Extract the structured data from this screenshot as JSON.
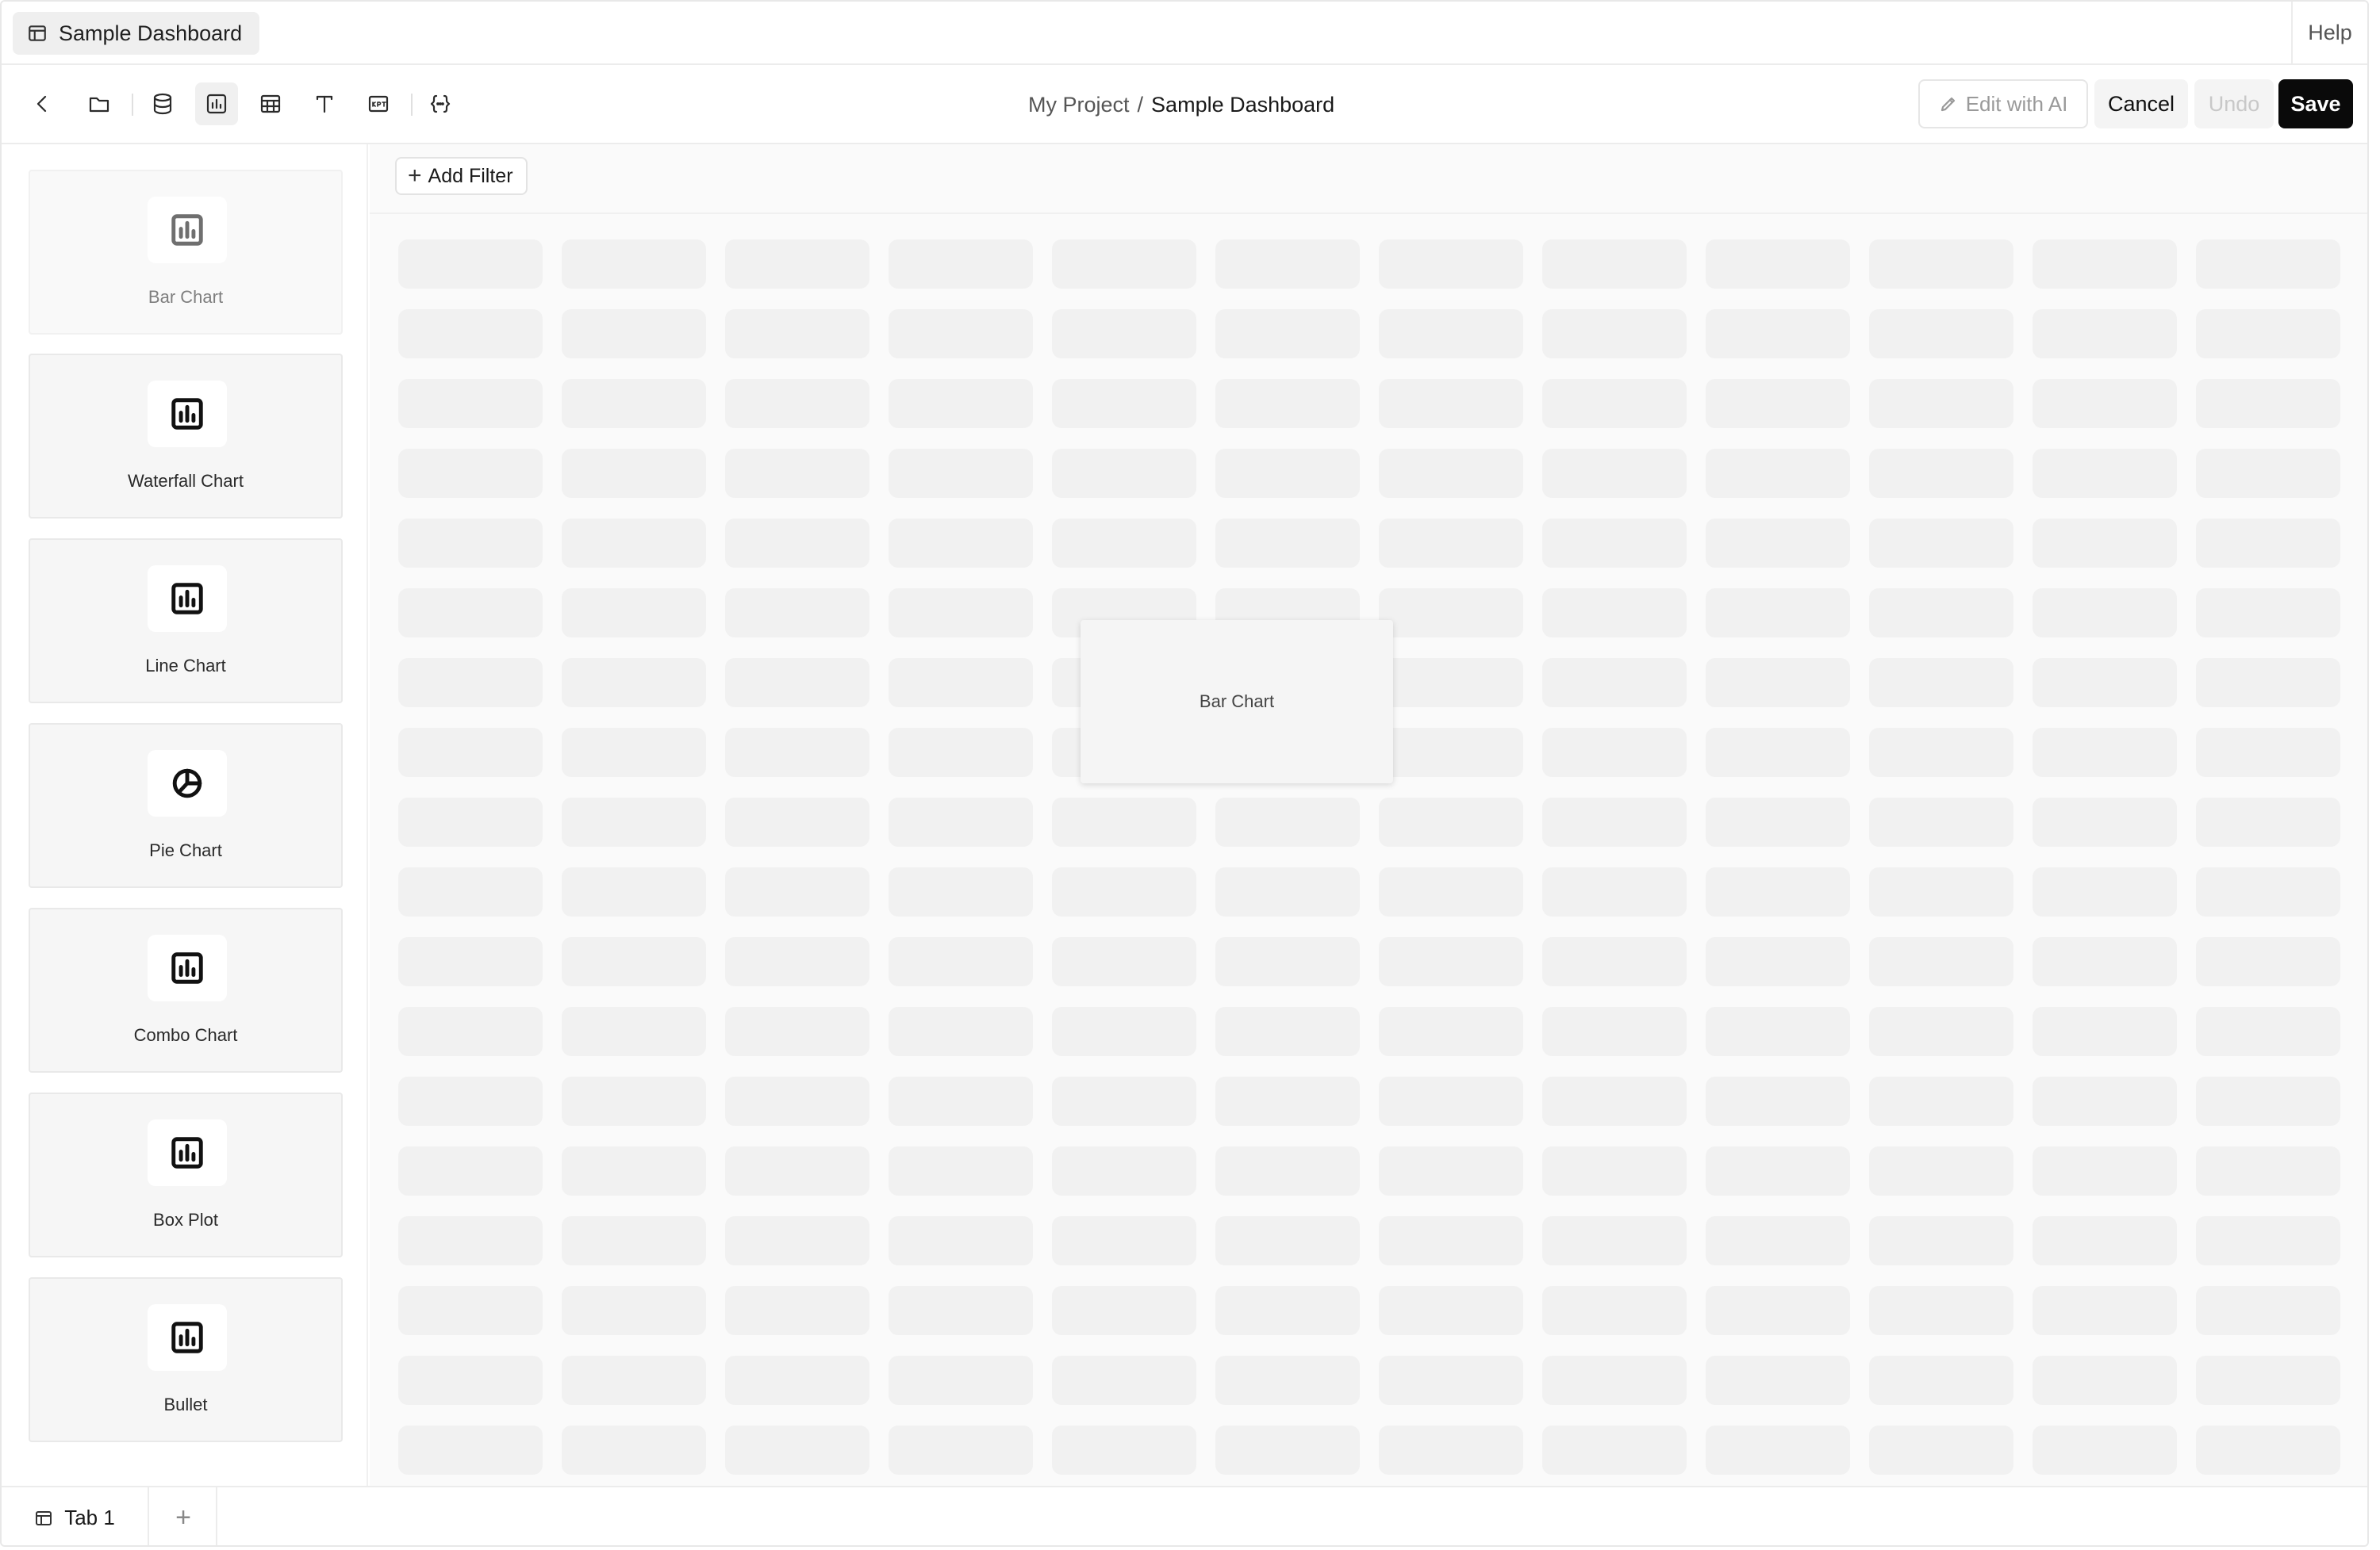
{
  "window": {
    "doc_tab_label": "Sample Dashboard",
    "help_label": "Help"
  },
  "toolbar": {
    "tools": [
      {
        "name": "back-icon"
      },
      {
        "name": "folder-icon"
      },
      {
        "name": "database-icon"
      },
      {
        "name": "chart-icon",
        "active": true
      },
      {
        "name": "table-icon"
      },
      {
        "name": "text-icon"
      },
      {
        "name": "kpi-icon"
      },
      {
        "name": "code-braces-icon"
      }
    ],
    "breadcrumb": {
      "project": "My Project",
      "separator": "/",
      "current": "Sample Dashboard"
    },
    "edit_ai_label": "Edit with AI",
    "cancel_label": "Cancel",
    "undo_label": "Undo",
    "save_label": "Save"
  },
  "sidebar": {
    "widgets": [
      {
        "label": "Bar Chart",
        "icon": "bar-chart-icon",
        "dimmed": true
      },
      {
        "label": "Waterfall Chart",
        "icon": "bar-chart-icon"
      },
      {
        "label": "Line Chart",
        "icon": "bar-chart-icon"
      },
      {
        "label": "Pie Chart",
        "icon": "pie-chart-icon"
      },
      {
        "label": "Combo Chart",
        "icon": "bar-chart-icon"
      },
      {
        "label": "Box Plot",
        "icon": "bar-chart-icon"
      },
      {
        "label": "Bullet",
        "icon": "bar-chart-icon"
      }
    ]
  },
  "canvas": {
    "add_filter_label": "Add Filter",
    "add_filter_icon": "plus-icon",
    "drag_ghost_label": "Bar Chart"
  },
  "bottom_tabs": {
    "tabs": [
      {
        "label": "Tab 1"
      }
    ],
    "add_tab_icon": "plus-icon"
  },
  "colors": {
    "save_button_bg": "#0a0a0a",
    "canvas_bg": "#fafafa",
    "grid_cell": "#f1f1f1"
  }
}
